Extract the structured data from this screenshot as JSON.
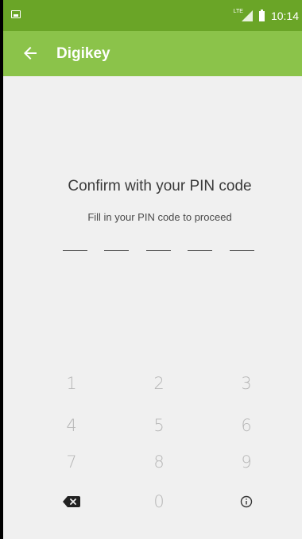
{
  "status_bar": {
    "network": "LTE",
    "time": "10:14"
  },
  "app_bar": {
    "back_icon": "arrow-back-icon",
    "title": "Digikey"
  },
  "prompt": {
    "title": "Confirm with your PIN code",
    "subtitle": "Fill in your PIN code to proceed"
  },
  "pin": {
    "length": 5,
    "entered": 0
  },
  "keypad": {
    "keys": [
      "1",
      "2",
      "3",
      "4",
      "5",
      "6",
      "7",
      "8",
      "9",
      "0"
    ],
    "delete_icon": "backspace-icon",
    "info_icon": "info-icon"
  },
  "colors": {
    "status_bar": "#6aa527",
    "app_bar": "#8bc34a",
    "background": "#f0f0f0"
  }
}
